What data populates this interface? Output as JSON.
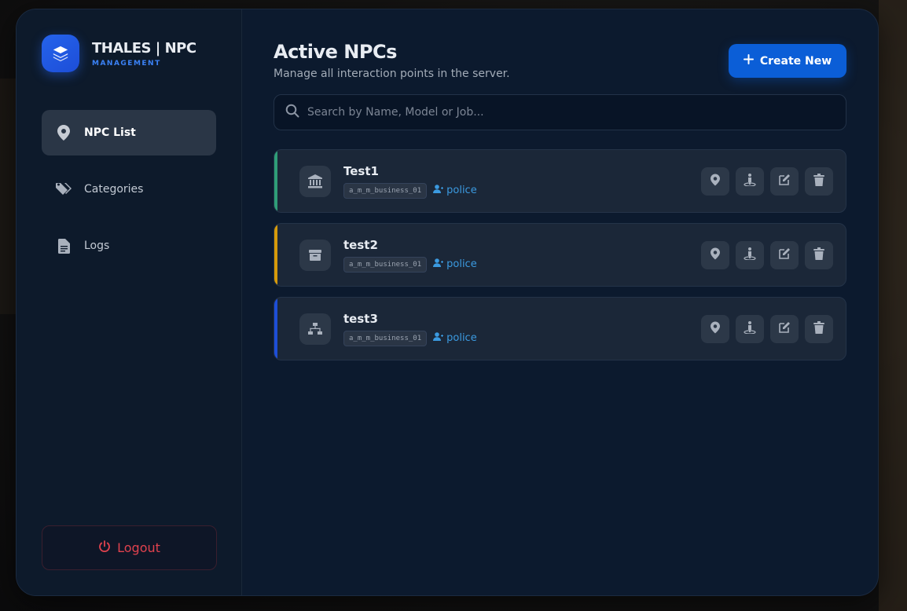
{
  "brand": {
    "title": "THALES | NPC",
    "subtitle": "MANAGEMENT",
    "icon": "layers-icon"
  },
  "nav": {
    "items": [
      {
        "label": "NPC List",
        "icon": "map-pin-icon",
        "active": true
      },
      {
        "label": "Categories",
        "icon": "tags-icon",
        "active": false
      },
      {
        "label": "Logs",
        "icon": "file-icon",
        "active": false
      }
    ],
    "logout_label": "Logout"
  },
  "header": {
    "title": "Active NPCs",
    "subtitle": "Manage all interaction points in the server.",
    "create_label": "Create New"
  },
  "search": {
    "placeholder": "Search by Name, Model or Job...",
    "value": ""
  },
  "npcs": [
    {
      "name": "Test1",
      "model": "a_m_m_business_01",
      "job": "police",
      "accent": "#2f9e78",
      "icon": "bank-icon"
    },
    {
      "name": "test2",
      "model": "a_m_m_business_01",
      "job": "police",
      "accent": "#d69a0a",
      "icon": "box-icon"
    },
    {
      "name": "test3",
      "model": "a_m_m_business_01",
      "job": "police",
      "accent": "#1d4ed8",
      "icon": "sitemap-icon"
    }
  ],
  "colors": {
    "accent": "#0b5ed7",
    "danger": "#e0424e",
    "link": "#3b9ae0"
  }
}
